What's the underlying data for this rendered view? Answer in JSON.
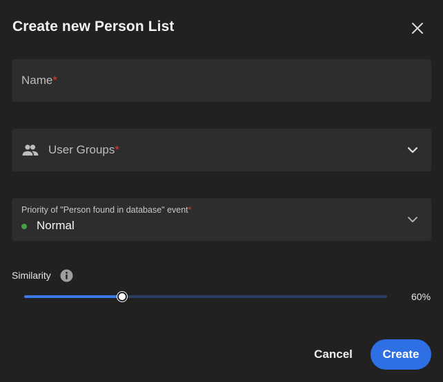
{
  "dialog": {
    "title": "Create new Person List",
    "close_icon": "close-icon"
  },
  "fields": {
    "name": {
      "label": "Name",
      "required_mark": "*",
      "value": ""
    },
    "user_groups": {
      "icon": "people-icon",
      "label": "User Groups",
      "required_mark": "*",
      "value": ""
    },
    "priority": {
      "label": "Priority of \"Person found in database\" event",
      "required_mark": "*",
      "value": "Normal",
      "status_color": "#43a047"
    }
  },
  "similarity": {
    "label": "Similarity",
    "info_icon": "info-icon",
    "value_percent": 60,
    "value_text": "60%",
    "fill_fraction": 0.27
  },
  "actions": {
    "cancel_label": "Cancel",
    "create_label": "Create"
  },
  "colors": {
    "background": "#212121",
    "field_background": "#2d2d2d",
    "accent": "#2f6fe4",
    "required": "#e53935"
  }
}
